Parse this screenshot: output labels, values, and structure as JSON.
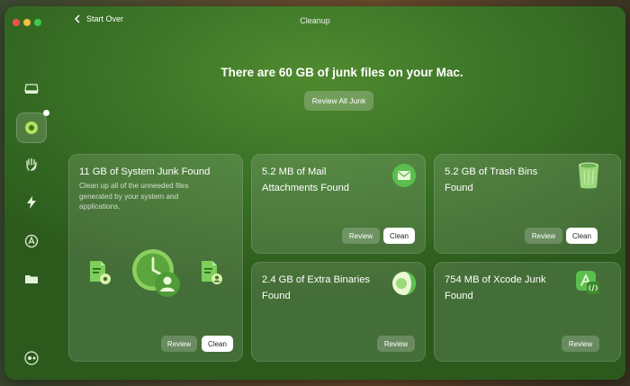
{
  "window": {
    "title": "Cleanup",
    "back_label": "Start Over"
  },
  "hero": {
    "title": "There are 60 GB of junk files on your Mac.",
    "review_all_label": "Review All Junk"
  },
  "sidebar": {
    "items": [
      {
        "name": "disk",
        "icon": "hard-drive-icon"
      },
      {
        "name": "cleanup",
        "icon": "cleanup-icon",
        "active": true
      },
      {
        "name": "protection",
        "icon": "hand-icon"
      },
      {
        "name": "performance",
        "icon": "lightning-icon"
      },
      {
        "name": "applications",
        "icon": "apps-icon"
      },
      {
        "name": "files",
        "icon": "folder-icon"
      }
    ]
  },
  "cards": {
    "system": {
      "title": "11 GB of System Junk Found",
      "description": "Clean up all of the unneeded files generated by your system and applications.",
      "review_label": "Review",
      "clean_label": "Clean"
    },
    "mail": {
      "title_line1": "5.2 MB of Mail",
      "title_line2": "Attachments Found",
      "review_label": "Review",
      "clean_label": "Clean"
    },
    "trash": {
      "title_line1": "5.2 GB of Trash Bins",
      "title_line2": "Found",
      "review_label": "Review",
      "clean_label": "Clean"
    },
    "binaries": {
      "title_line1": "2.4 GB of Extra Binaries",
      "title_line2": "Found",
      "review_label": "Review"
    },
    "xcode": {
      "title_line1": "754 MB of Xcode Junk",
      "title_line2": "Found",
      "review_label": "Review"
    }
  },
  "colors": {
    "accent_green": "#3c7428",
    "mail_icon_green": "#5bbf4f",
    "clean_button": "#ffffff"
  }
}
